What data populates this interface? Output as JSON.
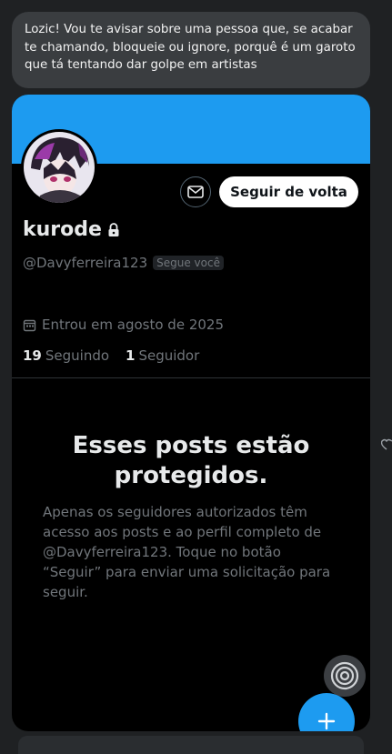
{
  "message": {
    "text": "Lozic! Vou te avisar sobre uma pessoa que, se acabar te chamando, bloqueie ou ignore, porquê é um garoto que tá tentando dar golpe em artistas"
  },
  "profile": {
    "display_name": "kurode",
    "handle": "@Davyferreira123",
    "follows_you_badge": "Segue você",
    "joined": "Entrou em agosto de 2025",
    "following_count": "19",
    "following_label": "Seguindo",
    "followers_count": "1",
    "followers_label": "Seguidor",
    "follow_back_label": "Seguir de volta",
    "banner_color": "#1d9bf0"
  },
  "protected": {
    "title": "Esses posts estão protegidos.",
    "description": "Apenas os seguidores autorizados têm acesso aos posts e ao perfil completo de @Davyferreira123. Toque no botão “Seguir” para enviar uma solicitação para seguir."
  },
  "icons": {
    "message": "envelope-icon",
    "lock": "lock-icon",
    "calendar": "calendar-icon",
    "grok": "grok-icon",
    "compose": "plus-icon",
    "heart": "heart-icon"
  },
  "colors": {
    "accent": "#1d9bf0",
    "background": "#000000",
    "bubble": "#3a3d40",
    "muted_text": "#71767b"
  }
}
